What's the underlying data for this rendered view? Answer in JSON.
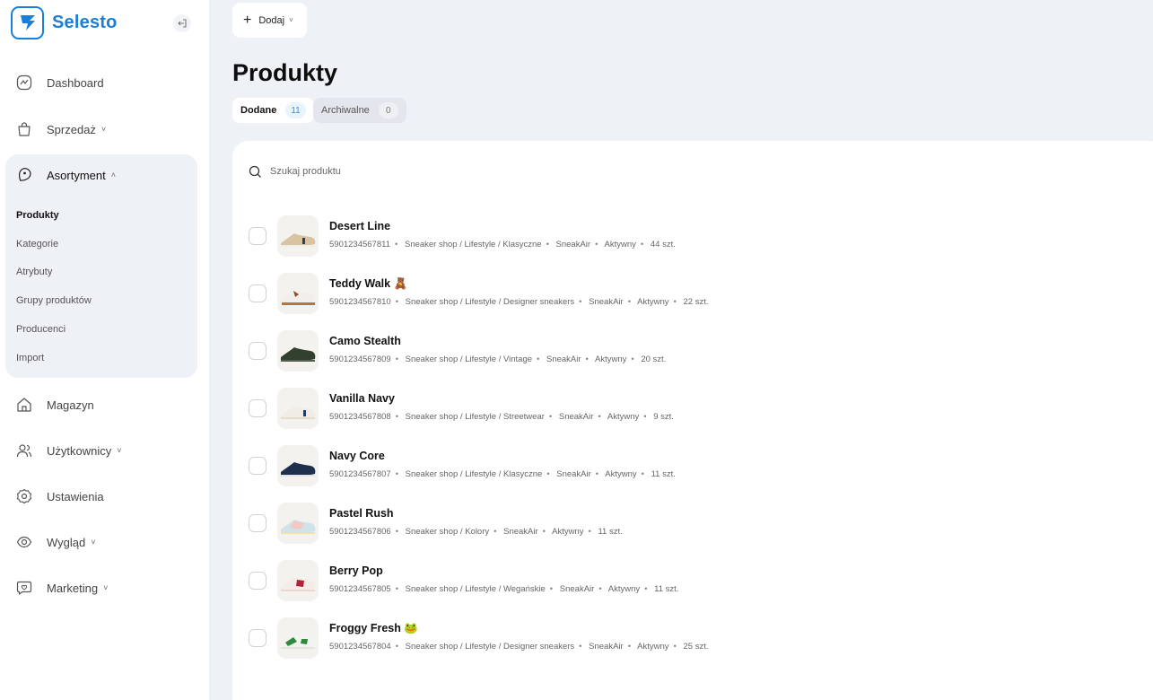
{
  "brand": {
    "name": "Selesto"
  },
  "sidebar": {
    "items": [
      {
        "label": "Dashboard",
        "icon": "chart-line-icon",
        "chevron": ""
      },
      {
        "label": "Sprzedaż",
        "icon": "shopping-bag-icon",
        "chevron": "˅"
      },
      {
        "label": "Asortyment",
        "icon": "tag-icon",
        "chevron": "˄"
      },
      {
        "label": "Magazyn",
        "icon": "warehouse-icon",
        "chevron": ""
      },
      {
        "label": "Użytkownicy",
        "icon": "users-icon",
        "chevron": "˅"
      },
      {
        "label": "Ustawienia",
        "icon": "gear-icon",
        "chevron": ""
      },
      {
        "label": "Wygląd",
        "icon": "eye-icon",
        "chevron": "˅"
      },
      {
        "label": "Marketing",
        "icon": "chat-heart-icon",
        "chevron": "˅"
      }
    ],
    "subitems": [
      "Produkty",
      "Kategorie",
      "Atrybuty",
      "Grupy produktów",
      "Producenci",
      "Import"
    ]
  },
  "toolbar": {
    "add_label": "Dodaj",
    "add_chevron": "˅"
  },
  "page": {
    "title": "Produkty"
  },
  "tabs": [
    {
      "label": "Dodane",
      "count": "11"
    },
    {
      "label": "Archiwalne",
      "count": "0"
    }
  ],
  "search": {
    "placeholder": "Szukaj produktu",
    "value": ""
  },
  "products": [
    {
      "name": "Desert Line",
      "emoji": "",
      "code": "5901234567811",
      "category": "Sneaker shop / Lifestyle / Klasyczne",
      "brand": "SneakAir",
      "status": "Aktywny",
      "stock": "44 szt."
    },
    {
      "name": "Teddy Walk",
      "emoji": "🧸",
      "code": "5901234567810",
      "category": "Sneaker shop / Lifestyle / Designer sneakers",
      "brand": "SneakAir",
      "status": "Aktywny",
      "stock": "22 szt."
    },
    {
      "name": "Camo Stealth",
      "emoji": "",
      "code": "5901234567809",
      "category": "Sneaker shop / Lifestyle / Vintage",
      "brand": "SneakAir",
      "status": "Aktywny",
      "stock": "20 szt."
    },
    {
      "name": "Vanilla Navy",
      "emoji": "",
      "code": "5901234567808",
      "category": "Sneaker shop / Lifestyle / Streetwear",
      "brand": "SneakAir",
      "status": "Aktywny",
      "stock": "9 szt."
    },
    {
      "name": "Navy Core",
      "emoji": "",
      "code": "5901234567807",
      "category": "Sneaker shop / Lifestyle / Klasyczne",
      "brand": "SneakAir",
      "status": "Aktywny",
      "stock": "11 szt."
    },
    {
      "name": "Pastel Rush",
      "emoji": "",
      "code": "5901234567806",
      "category": "Sneaker shop / Kolory",
      "brand": "SneakAir",
      "status": "Aktywny",
      "stock": "11 szt."
    },
    {
      "name": "Berry Pop",
      "emoji": "",
      "code": "5901234567805",
      "category": "Sneaker shop / Lifestyle / Wegańskie",
      "brand": "SneakAir",
      "status": "Aktywny",
      "stock": "11 szt."
    },
    {
      "name": "Froggy Fresh",
      "emoji": "🐸",
      "code": "5901234567804",
      "category": "Sneaker shop / Lifestyle / Designer sneakers",
      "brand": "SneakAir",
      "status": "Aktywny",
      "stock": "25 szt."
    }
  ],
  "colors": {
    "accent": "#1b7ed8",
    "page_bg": "#eef1f6",
    "panel_bg": "#ffffff"
  }
}
